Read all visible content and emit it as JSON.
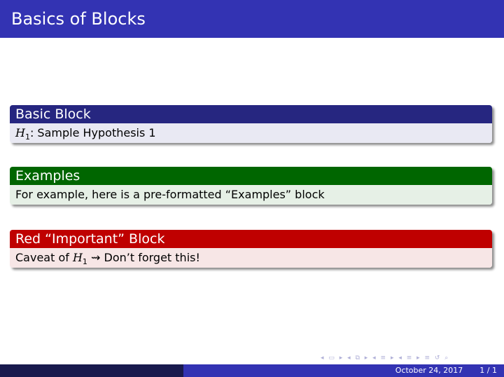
{
  "frame": {
    "title": "Basics of Blocks"
  },
  "blocks": [
    {
      "title": "Basic Block",
      "title_color": "#262680",
      "body_color": "#e9e9f3",
      "body": {
        "var": "H",
        "sub": "1",
        "text": ": Sample Hypothesis 1"
      }
    },
    {
      "title": "Examples",
      "title_color": "#006600",
      "body_color": "#e6f0e6",
      "body": {
        "text": "For example, here is a pre-formatted “Examples” block"
      }
    },
    {
      "title": "Red “Important” Block",
      "title_color": "#bf0000",
      "body_color": "#f7e6e6",
      "body": {
        "pre": "Caveat of ",
        "var": "H",
        "sub": "1",
        "post": " ⇝ Don’t forget this!"
      }
    }
  ],
  "footer": {
    "date": "October 24, 2017",
    "page": "1 / 1"
  },
  "nav": {
    "icons": "◂ ▭ ▸ ◂ ⧉ ▸ ◂ ≡ ▸ ◂ ≡ ▸ ≡ ↺ ⌕"
  }
}
